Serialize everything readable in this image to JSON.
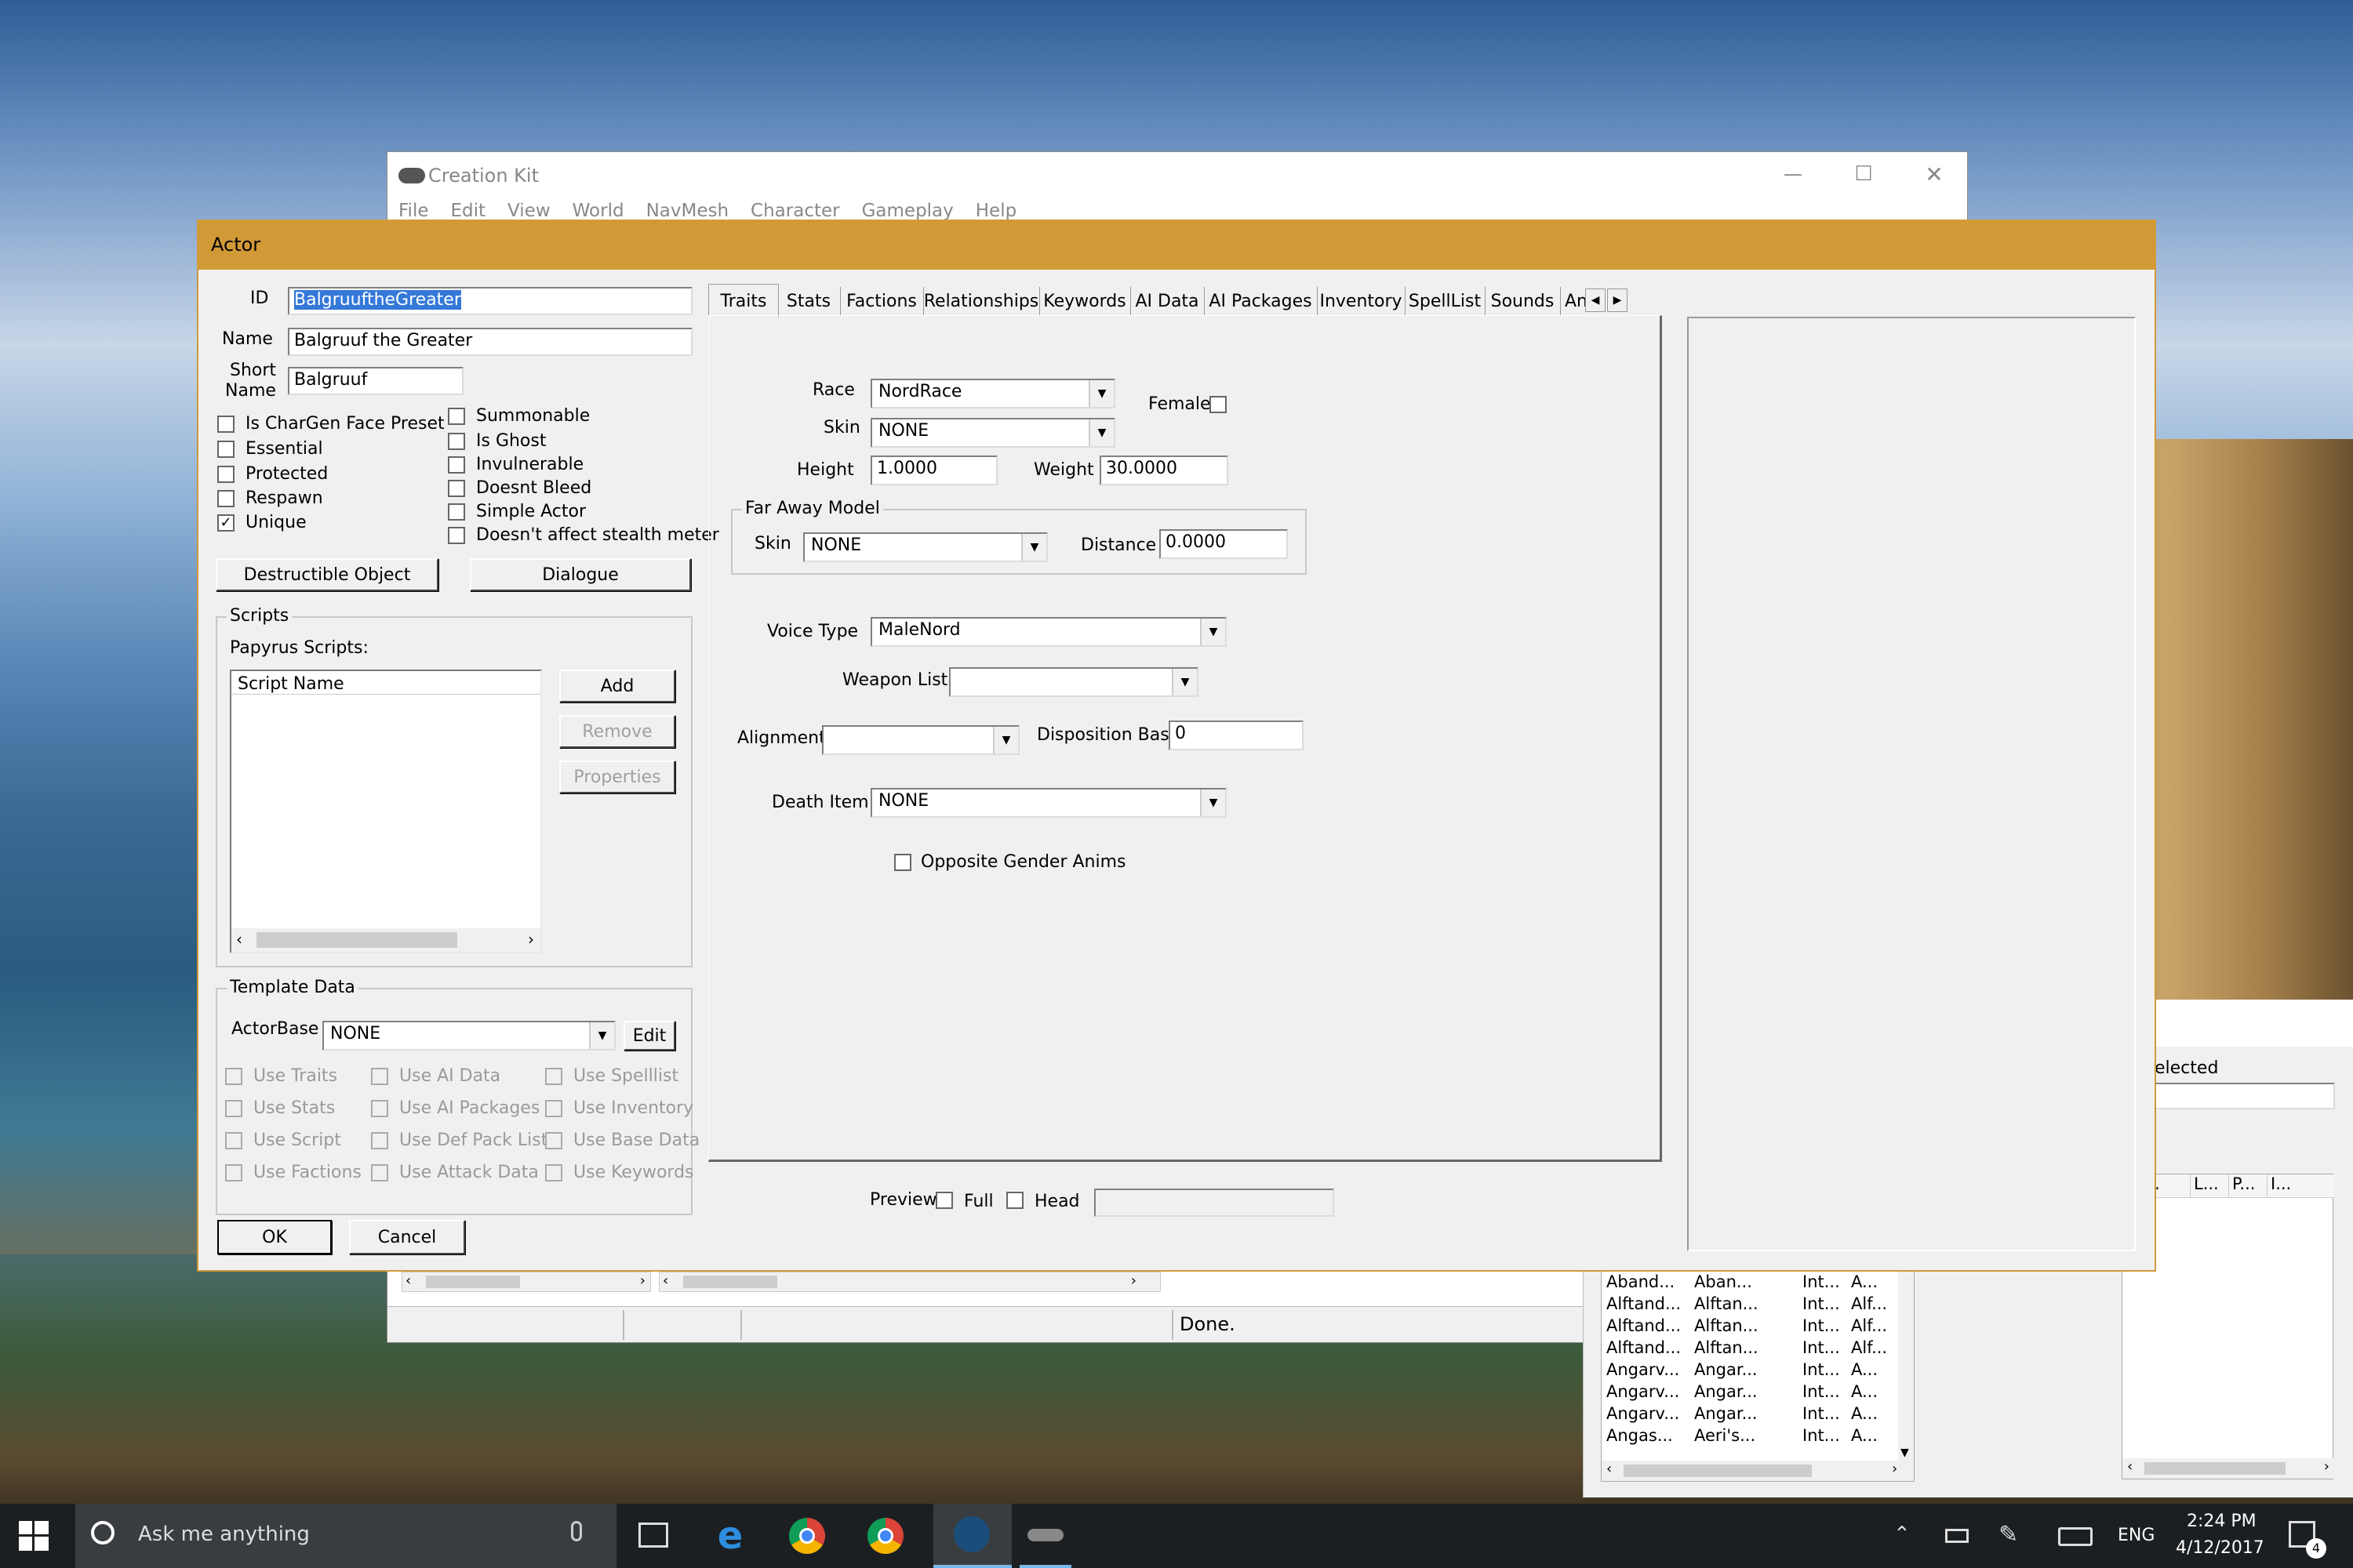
{
  "creation_kit": {
    "title": "Creation Kit",
    "menu": [
      "File",
      "Edit",
      "View",
      "World",
      "NavMesh",
      "Character",
      "Gameplay",
      "Help"
    ],
    "status": "Done."
  },
  "actor": {
    "title": "Actor",
    "id_label": "ID",
    "id_value": "BalgruuftheGreater",
    "name_label": "Name",
    "name_value": "Balgruuf the Greater",
    "short_label_1": "Short",
    "short_label_2": "Name",
    "short_value": "Balgruuf",
    "flags_left": [
      {
        "label": "Is CharGen Face Preset",
        "checked": false
      },
      {
        "label": "Essential",
        "checked": false
      },
      {
        "label": "Protected",
        "checked": false
      },
      {
        "label": "Respawn",
        "checked": false
      },
      {
        "label": "Unique",
        "checked": true
      }
    ],
    "flags_right": [
      {
        "label": "Summonable",
        "checked": false
      },
      {
        "label": "Is Ghost",
        "checked": false
      },
      {
        "label": "Invulnerable",
        "checked": false
      },
      {
        "label": "Doesnt Bleed",
        "checked": false
      },
      {
        "label": "Simple Actor",
        "checked": false
      },
      {
        "label": "Doesn't affect stealth meter",
        "checked": false
      }
    ],
    "destructible_btn": "Destructible Object",
    "dialogue_btn": "Dialogue",
    "scripts": {
      "group": "Scripts",
      "papyrus": "Papyrus Scripts:",
      "col": "Script Name",
      "add": "Add",
      "remove": "Remove",
      "properties": "Properties"
    },
    "template": {
      "group": "Template Data",
      "actorbase_label": "ActorBase",
      "actorbase_value": "NONE",
      "edit": "Edit",
      "col1": [
        "Use Traits",
        "Use Stats",
        "Use Script",
        "Use Factions"
      ],
      "col2": [
        "Use AI Data",
        "Use AI Packages",
        "Use Def Pack List",
        "Use Attack Data"
      ],
      "col3": [
        "Use Spelllist",
        "Use Inventory",
        "Use Base Data",
        "Use Keywords"
      ]
    },
    "ok": "OK",
    "cancel": "Cancel",
    "tabs": [
      "Traits",
      "Stats",
      "Factions",
      "Relationships",
      "Keywords",
      "AI Data",
      "AI Packages",
      "Inventory",
      "SpellList",
      "Sounds",
      "Anim"
    ],
    "traits": {
      "race_label": "Race",
      "race_value": "NordRace",
      "female_label": "Female",
      "skin_label": "Skin",
      "skin_value": "NONE",
      "height_label": "Height",
      "height_value": "1.0000",
      "weight_label": "Weight",
      "weight_value": "30.0000",
      "far_group": "Far Away Model",
      "far_skin_label": "Skin",
      "far_skin_value": "NONE",
      "distance_label": "Distance",
      "distance_value": "0.0000",
      "voice_label": "Voice Type",
      "voice_value": "MaleNord",
      "weapon_label": "Weapon List",
      "alignment_label": "Alignment",
      "disposition_label": "Disposition Base",
      "disposition_value": "0",
      "death_label": "Death Item",
      "death_value": "NONE",
      "opposite_label": "Opposite Gender Anims"
    },
    "preview": {
      "label": "Preview",
      "full": "Full",
      "head": "Head"
    }
  },
  "bg_window": {
    "selected": "elected",
    "cols": [
      "Lo...",
      "L...",
      "P...",
      "I..."
    ],
    "rows": [
      [
        "Aband...",
        "Aban...",
        "Int...",
        "A..."
      ],
      [
        "Alftand...",
        "Alftan...",
        "Int...",
        "Alf..."
      ],
      [
        "Alftand...",
        "Alftan...",
        "Int...",
        "Alf..."
      ],
      [
        "Alftand...",
        "Alftan...",
        "Int...",
        "Alf..."
      ],
      [
        "Angarv...",
        "Angar...",
        "Int...",
        "A..."
      ],
      [
        "Angarv...",
        "Angar...",
        "Int...",
        "A..."
      ],
      [
        "Angarv...",
        "Angar...",
        "Int...",
        "A..."
      ],
      [
        "Angas...",
        "Aeri's...",
        "Int...",
        "A..."
      ]
    ]
  },
  "taskbar": {
    "search": "Ask me anything",
    "lang": "ENG",
    "time": "2:24 PM",
    "date": "4/12/2017",
    "notif": "4"
  }
}
